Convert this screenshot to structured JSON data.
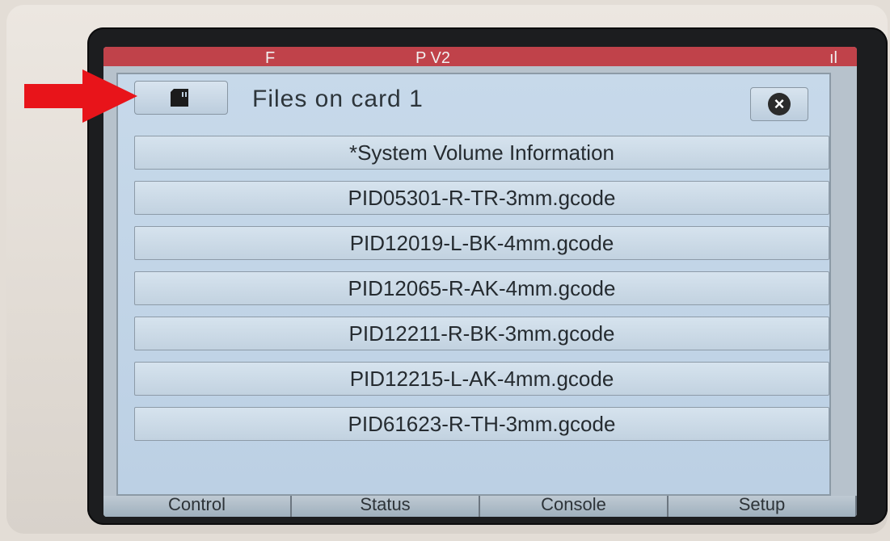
{
  "top_bar": {
    "left_text": "F",
    "center_text": "P V2",
    "right_text": "ıl"
  },
  "dialog": {
    "title": "Files on card 1",
    "sd_icon": "sd-card-icon",
    "close_icon": "close-icon",
    "files": [
      "*System Volume Information",
      "PID05301-R-TR-3mm.gcode",
      "PID12019-L-BK-4mm.gcode",
      "PID12065-R-AK-4mm.gcode",
      "PID12211-R-BK-3mm.gcode",
      "PID12215-L-AK-4mm.gcode",
      "PID61623-R-TH-3mm.gcode"
    ]
  },
  "bottom_tabs": [
    "Control",
    "Status",
    "Console",
    "Setup"
  ],
  "colors": {
    "arrow": "#e8141a",
    "top_bar": "#c0424a",
    "dialog_bg": "#c3d6e8"
  }
}
